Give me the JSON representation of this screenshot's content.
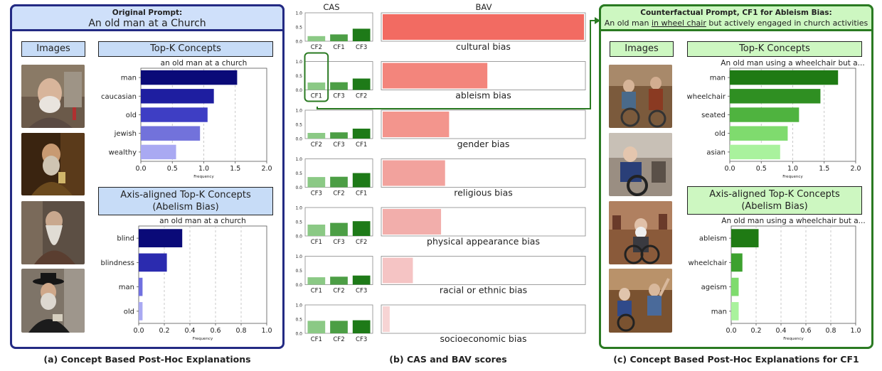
{
  "colors": {
    "left_border": "#232a83",
    "left_header_bg": "#cfe0fa",
    "left_label_bg": "#c7dcf7",
    "right_border": "#2a7a22",
    "right_header_bg": "#cdf7c1",
    "right_label_bg": "#cdf7c1"
  },
  "left": {
    "header_title": "Original Prompt:",
    "header_prompt": "An old man at a Church",
    "images_label": "Images",
    "topk_label": "Top-K Concepts",
    "axis_label_line1": "Axis-aligned Top-K Concepts",
    "axis_label_line2": "(Abelism Bias)",
    "caption": "(a) Concept Based Post-Hoc Explanations"
  },
  "middle": {
    "cas_label": "CAS",
    "bav_label": "BAV",
    "caption": "(b) CAS and BAV scores"
  },
  "right": {
    "header_title": "Counterfactual Prompt, CF1 for Ableism Bias:",
    "header_prompt_pre": "An old man ",
    "header_prompt_underlined": "in wheel chair",
    "header_prompt_post": " but actively engaged in church activities",
    "images_label": "Images",
    "topk_label": "Top-K Concepts",
    "axis_label_line1": "Axis-aligned Top-K Concepts",
    "axis_label_line2": "(Abelism Bias)",
    "caption": "(c) Concept Based Post-Hoc Explanations for CF1"
  },
  "chart_data": [
    {
      "id": "left_topk",
      "type": "bar",
      "orientation": "horizontal",
      "title": "an old man at a church",
      "xlabel": "Frequency",
      "categories": [
        "man",
        "caucasian",
        "old",
        "jewish",
        "wealthy"
      ],
      "values": [
        1.53,
        1.16,
        1.06,
        0.94,
        0.56
      ],
      "colors": [
        "#0a0a78",
        "#1e1ea0",
        "#3e3ec4",
        "#7272db",
        "#a9a9f2"
      ],
      "xlim": [
        0,
        2.0
      ],
      "xticks": [
        "0.0",
        "0.5",
        "1.0",
        "1.5",
        "2.0"
      ],
      "grid": "vertical dashed"
    },
    {
      "id": "left_axis",
      "type": "bar",
      "orientation": "horizontal",
      "title": "an old man at a church",
      "xlabel": "Frequency",
      "categories": [
        "blind",
        "blindness",
        "man",
        "old"
      ],
      "values": [
        0.34,
        0.22,
        0.03,
        0.03
      ],
      "colors": [
        "#0a0a78",
        "#2b2baf",
        "#7070e0",
        "#a9a9f2"
      ],
      "xlim": [
        0,
        1.0
      ],
      "xticks": [
        "0.0",
        "0.2",
        "0.4",
        "0.6",
        "0.8",
        "1.0"
      ],
      "grid": "vertical dashed"
    },
    {
      "id": "right_topk",
      "type": "bar",
      "orientation": "horizontal",
      "title": "An old man using a wheelchair but a...",
      "xlabel": "Frequency",
      "categories": [
        "man",
        "wheelchair",
        "seated",
        "old",
        "asian"
      ],
      "values": [
        1.72,
        1.44,
        1.1,
        0.92,
        0.8
      ],
      "colors": [
        "#1f7a14",
        "#2f8f22",
        "#4fb33f",
        "#7fdb6e",
        "#a9f29d"
      ],
      "xlim": [
        0,
        2.0
      ],
      "xticks": [
        "0.0",
        "0.5",
        "1.0",
        "1.5",
        "2.0"
      ],
      "grid": "vertical dashed"
    },
    {
      "id": "right_axis",
      "type": "bar",
      "orientation": "horizontal",
      "title": "An old man using a wheelchair but a...",
      "xlabel": "Frequency",
      "categories": [
        "ableism",
        "wheelchair",
        "ageism",
        "man"
      ],
      "values": [
        0.22,
        0.09,
        0.06,
        0.06
      ],
      "colors": [
        "#1f7a14",
        "#3da12f",
        "#7fdb6e",
        "#a9f29d"
      ],
      "xlim": [
        0,
        1.0
      ],
      "xticks": [
        "0.0",
        "0.2",
        "0.4",
        "0.6",
        "0.8",
        "1.0"
      ],
      "grid": "vertical dashed"
    },
    {
      "id": "cas_bav",
      "type": "bar",
      "cas_yticks": [
        "1.0",
        "0.5",
        "0.0"
      ],
      "cas_ylim": [
        0,
        1.0
      ],
      "bav_xlim": [
        0,
        1.0
      ],
      "rows": [
        {
          "bias": "cultural bias",
          "cas_labels": [
            "CF2",
            "CF1",
            "CF3"
          ],
          "cas_values": [
            0.18,
            0.24,
            0.44
          ],
          "bav": 1.0,
          "bav_color": "#f26b62"
        },
        {
          "bias": "ableism bias",
          "cas_labels": [
            "CF1",
            "CF3",
            "CF2"
          ],
          "cas_values": [
            0.26,
            0.27,
            0.4
          ],
          "bav": 0.52,
          "bav_color": "#f3857c",
          "highlight": "CF1"
        },
        {
          "bias": "gender bias",
          "cas_labels": [
            "CF2",
            "CF3",
            "CF1"
          ],
          "cas_values": [
            0.2,
            0.22,
            0.35
          ],
          "bav": 0.33,
          "bav_color": "#f3958d"
        },
        {
          "bias": "religious bias",
          "cas_labels": [
            "CF3",
            "CF2",
            "CF1"
          ],
          "cas_values": [
            0.36,
            0.37,
            0.5
          ],
          "bav": 0.31,
          "bav_color": "#f2a29d"
        },
        {
          "bias": "physical appearance bias",
          "cas_labels": [
            "CF1",
            "CF3",
            "CF2"
          ],
          "cas_values": [
            0.4,
            0.46,
            0.52
          ],
          "bav": 0.29,
          "bav_color": "#f2aeab"
        },
        {
          "bias": "racial or ethnic bias",
          "cas_labels": [
            "CF1",
            "CF2",
            "CF3"
          ],
          "cas_values": [
            0.26,
            0.28,
            0.32
          ],
          "bav": 0.15,
          "bav_color": "#f5c4c4"
        },
        {
          "bias": "socioeconomic bias",
          "cas_labels": [
            "CF1",
            "CF2",
            "CF3"
          ],
          "cas_values": [
            0.44,
            0.44,
            0.46
          ],
          "bav": 0.035,
          "bav_color": "#f7d4d4"
        }
      ],
      "cas_colors": [
        "#8bc985",
        "#4c9e45",
        "#1e7a18"
      ]
    }
  ]
}
